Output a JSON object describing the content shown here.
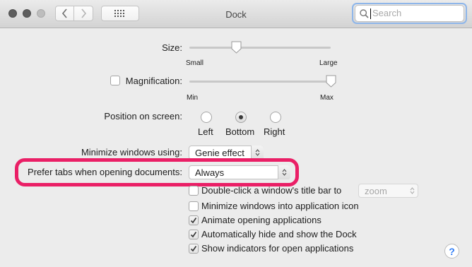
{
  "window": {
    "title": "Dock"
  },
  "search": {
    "placeholder": "Search",
    "value": ""
  },
  "icons": {
    "back": "chevron-left-icon",
    "forward": "chevron-right-icon",
    "grid": "grid-icon",
    "search": "search-icon",
    "help": "help-icon"
  },
  "size": {
    "label": "Size:",
    "min_label": "Small",
    "max_label": "Large",
    "value": 0.33
  },
  "magnification": {
    "label": "Magnification:",
    "checked": false,
    "min_label": "Min",
    "max_label": "Max",
    "value": 1.0
  },
  "position": {
    "label": "Position on screen:",
    "options": [
      "Left",
      "Bottom",
      "Right"
    ],
    "selected": "Bottom"
  },
  "minimize": {
    "label": "Minimize windows using:",
    "value": "Genie effect"
  },
  "prefer_tabs": {
    "label": "Prefer tabs when opening documents:",
    "value": "Always"
  },
  "checkboxes": [
    {
      "label": "Double-click a window's title bar to",
      "checked": false,
      "popup": "zoom"
    },
    {
      "label": "Minimize windows into application icon",
      "checked": false
    },
    {
      "label": "Animate opening applications",
      "checked": true
    },
    {
      "label": "Automatically hide and show the Dock",
      "checked": true
    },
    {
      "label": "Show indicators for open applications",
      "checked": true
    }
  ],
  "help": {
    "label": "?"
  },
  "colors": {
    "highlight": "#ea1f66",
    "focus_ring": "#8eb6ea",
    "help_blue": "#2e7cf6"
  }
}
